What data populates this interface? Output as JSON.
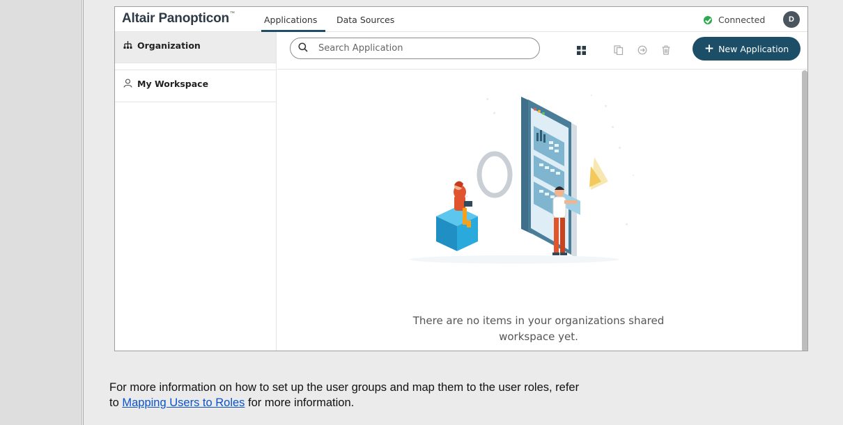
{
  "app": {
    "logo": "Altair Panopticon",
    "logo_tm": "™",
    "tabs": [
      "Applications",
      "Data Sources"
    ],
    "status": "Connected",
    "avatar_initial": "D",
    "colors": {
      "accent": "#1d4e68",
      "connected": "#2fa84f"
    }
  },
  "sidebar": {
    "items": [
      {
        "label": "Organization",
        "icon": "organization-icon",
        "active": true
      },
      {
        "label": "My Workspace",
        "icon": "user-icon",
        "active": false
      }
    ]
  },
  "toolbar": {
    "search_placeholder": "Search Application",
    "new_button_label": "New Application",
    "icons": [
      "grid-view-icon",
      "copy-icon",
      "move-icon",
      "trash-icon"
    ]
  },
  "main": {
    "empty_message_line1": "There are no items in your organizations shared",
    "empty_message_line2": "workspace yet."
  },
  "footnote": {
    "text_before": "For more information on how to set up the user groups and map them to the user roles, refer",
    "text_to": "to ",
    "link_text": "Mapping Users to Roles",
    "text_after": " for more information."
  }
}
